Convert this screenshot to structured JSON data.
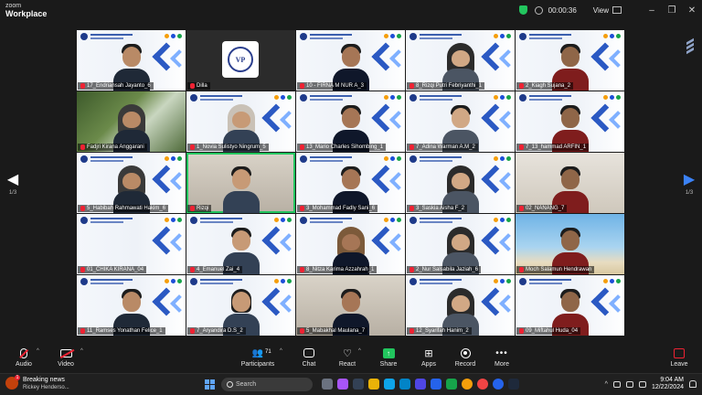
{
  "app": {
    "logo_top": "zoom",
    "logo_bottom": "Workplace"
  },
  "titlebar": {
    "timer": "00:00:36",
    "view_label": "View",
    "minimize": "–",
    "maximize": "❐",
    "close": "✕"
  },
  "pagination": {
    "left_page": "1/3",
    "right_page": "1/3"
  },
  "participants": [
    {
      "name": "17_Endriansah Jayanto_6",
      "bg": "banner",
      "person": "male"
    },
    {
      "name": "Dilla",
      "bg": "dark",
      "person": "logo"
    },
    {
      "name": "10 - FIRNA M NUR A_3",
      "bg": "banner",
      "person": "male"
    },
    {
      "name": "8_Rizqi Putri Febriyanthi_1",
      "bg": "banner",
      "person": "hijab"
    },
    {
      "name": "2_Kiagh Sujana_2",
      "bg": "banner",
      "person": "male"
    },
    {
      "name": "Fadjri Kirana Anggarani",
      "bg": "nature",
      "person": "hijab"
    },
    {
      "name": "1_Novia Sulistyo Ningrum_5",
      "bg": "banner",
      "person": "hijab"
    },
    {
      "name": "13_Mario Charles Sihombing_1",
      "bg": "banner",
      "person": "male"
    },
    {
      "name": "7_Adina Warman A.M_2",
      "bg": "banner",
      "person": "male"
    },
    {
      "name": "7_13_hammad ARFIN_1",
      "bg": "banner",
      "person": "male"
    },
    {
      "name": "5_Habibah Rahmawati Hakim_6",
      "bg": "banner",
      "person": "hijab"
    },
    {
      "name": "Rizqi",
      "bg": "room",
      "person": "male",
      "active": true
    },
    {
      "name": "3_Mohammad Fadly Sani_6",
      "bg": "banner",
      "person": "male"
    },
    {
      "name": "3_Saskia Aisha F_2",
      "bg": "banner",
      "person": "hijab"
    },
    {
      "name": "02_NANANG_7",
      "bg": "office",
      "person": "male"
    },
    {
      "name": "01_CHIKA KIRANA_04",
      "bg": "banner",
      "person": "none"
    },
    {
      "name": "4_Emanuel Zai_4",
      "bg": "banner",
      "person": "male"
    },
    {
      "name": "8_Nitza Karima Azzahrah_1",
      "bg": "banner",
      "person": "hijab"
    },
    {
      "name": "2_Nur Salsabila Jaziah_6",
      "bg": "banner",
      "person": "hijab"
    },
    {
      "name": "Moch Salamun Hendrawan",
      "bg": "beach",
      "person": "male"
    },
    {
      "name": "11_Ramses Yonathan Felice_1",
      "bg": "banner",
      "person": "male"
    },
    {
      "name": "7_Aryandira D.S_2",
      "bg": "banner",
      "person": "female"
    },
    {
      "name": "5_Mabakhal Maulana_7",
      "bg": "room",
      "person": "male"
    },
    {
      "name": "12_Syarifah Hanim_2",
      "bg": "banner",
      "person": "hijab"
    },
    {
      "name": "09_Miftahul Huda_04",
      "bg": "banner",
      "person": "male"
    }
  ],
  "toolbar": {
    "audio": "Audio",
    "video": "Video",
    "participants": "Participants",
    "participants_count": "71",
    "chat": "Chat",
    "react": "React",
    "share": "Share",
    "apps": "Apps",
    "record": "Record",
    "more": "More",
    "leave": "Leave"
  },
  "taskbar": {
    "news_title": "Breaking news",
    "news_sub": "Rickey Henderso...",
    "search_placeholder": "Search",
    "time": "9:04 AM",
    "date": "12/22/2024"
  },
  "colors": {
    "accent_green": "#22c55e",
    "banner_blue": "#2b59c3",
    "leave_red": "#e23"
  }
}
